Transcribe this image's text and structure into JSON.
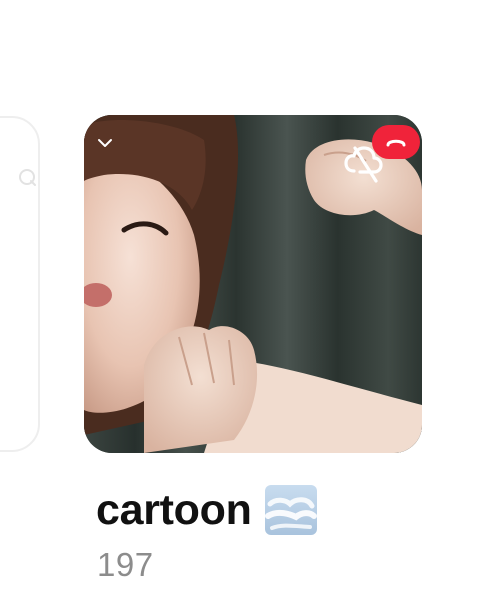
{
  "card": {
    "title": "cartoon",
    "title_emoji": "fog-emoji",
    "count": "197"
  },
  "icons": {
    "collapse": "chevron-down-icon",
    "sync": "sync-off-icon",
    "hangup": "hang-up-icon",
    "prev_card": "generic-icon"
  },
  "colors": {
    "hangup": "#f0233a",
    "title": "#111111",
    "count": "#8c8c8c",
    "card_border": "#eeeeee"
  }
}
